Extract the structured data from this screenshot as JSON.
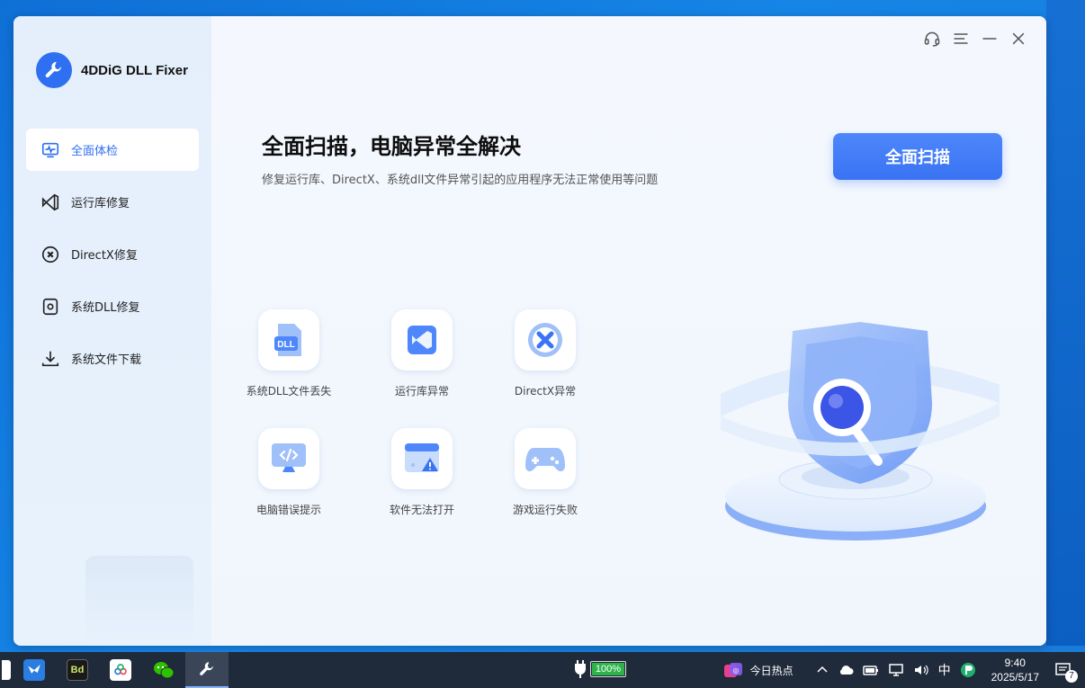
{
  "app": {
    "name": "4DDiG DLL Fixer"
  },
  "sidebar": {
    "items": [
      {
        "label": "全面体检",
        "icon": "pulse-icon",
        "active": true
      },
      {
        "label": "运行库修复",
        "icon": "vs-runtime-icon",
        "active": false
      },
      {
        "label": "DirectX修复",
        "icon": "x-circle-icon",
        "active": false
      },
      {
        "label": "系统DLL修复",
        "icon": "gear-box-icon",
        "active": false
      },
      {
        "label": "系统文件下载",
        "icon": "download-icon",
        "active": false
      }
    ]
  },
  "main": {
    "headline": "全面扫描，电脑异常全解决",
    "subline": "修复运行库、DirectX、系统dll文件异常引起的应用程序无法正常使用等问题",
    "scan_button": "全面扫描",
    "issues": [
      {
        "label": "系统DLL文件丢失",
        "icon": "dll-file-icon"
      },
      {
        "label": "运行库异常",
        "icon": "vs-runtime-icon"
      },
      {
        "label": "DirectX异常",
        "icon": "directx-icon"
      },
      {
        "label": "电脑错误提示",
        "icon": "monitor-code-icon"
      },
      {
        "label": "软件无法打开",
        "icon": "window-warning-icon"
      },
      {
        "label": "游戏运行失败",
        "icon": "gamepad-icon"
      }
    ],
    "dll_badge": "DLL"
  },
  "window_controls": [
    "headset-icon",
    "menu-icon",
    "minimize-icon",
    "close-icon"
  ],
  "taskbar": {
    "battery": "100%",
    "news": "今日热点",
    "ime": "中",
    "time": "9:40",
    "date": "2025/5/17",
    "notification_count": "7",
    "bd_label": "Bd"
  },
  "colors": {
    "accent": "#3a73f3",
    "sidebar_bg": "#e4effb",
    "main_bg": "#f1f6fd",
    "taskbar_bg": "#1f2a3a"
  }
}
